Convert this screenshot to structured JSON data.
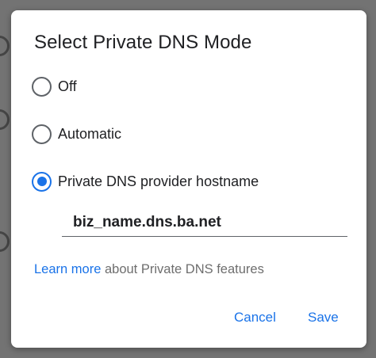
{
  "dialog": {
    "title": "Select Private DNS Mode",
    "options": [
      {
        "label": "Off",
        "selected": false
      },
      {
        "label": "Automatic",
        "selected": false
      },
      {
        "label": "Private DNS provider hostname",
        "selected": true
      }
    ],
    "hostname_value": "biz_name.dns.ba.net",
    "learn_more_link": "Learn more",
    "learn_more_rest": " about Private DNS features",
    "cancel_label": "Cancel",
    "save_label": "Save"
  },
  "colors": {
    "accent": "#1a73e8",
    "scrim": "#737373",
    "dialog_bg": "#ffffff",
    "text": "#202124",
    "secondary_text": "#6e6e6e"
  }
}
